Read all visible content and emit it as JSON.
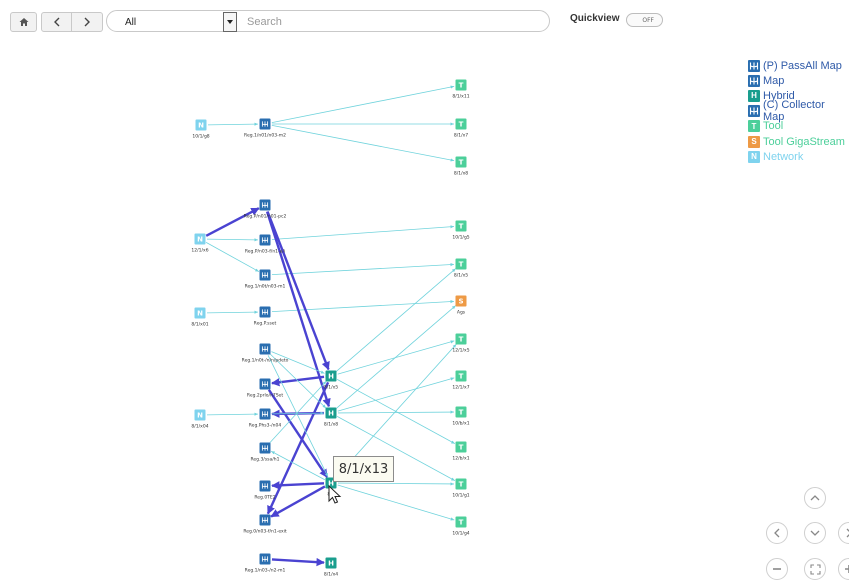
{
  "toolbar": {
    "home_icon": "home-icon",
    "back_icon": "chevron-left-icon",
    "forward_icon": "chevron-right-icon",
    "scope_value": "All",
    "search_placeholder": "Search",
    "quickview_label": "Quickview",
    "quickview_state": "OFF"
  },
  "legend": [
    {
      "badge": "",
      "icon": "passall-map-icon",
      "label": "(P) PassAll Map",
      "color": "#2a6eb0",
      "text_color": "#2f5aa8"
    },
    {
      "badge": "",
      "icon": "map-icon",
      "label": "Map",
      "color": "#2a6eb0",
      "text_color": "#2f5aa8"
    },
    {
      "badge": "H",
      "icon": "hybrid-icon",
      "label": "Hybrid",
      "color": "#1a9e8e",
      "text_color": "#2f5aa8"
    },
    {
      "badge": "",
      "icon": "collector-map-icon",
      "label": "(C) Collector Map",
      "color": "#2a6eb0",
      "text_color": "#2f5aa8"
    },
    {
      "badge": "T",
      "icon": "tool-icon",
      "label": "Tool",
      "color": "#4ccf9a",
      "text_color": "#4ccf9a"
    },
    {
      "badge": "S",
      "icon": "tool-gigastream-icon",
      "label": "Tool GigaStream",
      "color": "#ee9a45",
      "text_color": "#4ccf9a"
    },
    {
      "badge": "N",
      "icon": "network-icon",
      "label": "Network",
      "color": "#7fd3ee",
      "text_color": "#7fd3ee"
    }
  ],
  "colors": {
    "map": "#2a6eb0",
    "hybrid": "#1a9e8e",
    "tool": "#4ccf9a",
    "gigastream": "#ee9a45",
    "network": "#7fd3ee",
    "thin_edge": "#70d3dc",
    "thick_edge": "#4a43d1"
  },
  "graph": {
    "nodes": [
      {
        "id": "n1",
        "type": "N",
        "label": "10/1/g8"
      },
      {
        "id": "m1",
        "type": "M",
        "label": "Reg.1/n01/n03-m2"
      },
      {
        "id": "t1",
        "type": "T",
        "label": "8/1/x11"
      },
      {
        "id": "t2",
        "type": "T",
        "label": "8/1/x7"
      },
      {
        "id": "t3",
        "type": "T",
        "label": "8/1/x8"
      },
      {
        "id": "m2",
        "type": "M",
        "label": "Reg.P/n01/n01-pc2"
      },
      {
        "id": "n2",
        "type": "N",
        "label": "12/1/x6"
      },
      {
        "id": "m3",
        "type": "M",
        "label": "Reg.P/n03-f/n1-a/i"
      },
      {
        "id": "t4",
        "type": "T",
        "label": "10/1/g5"
      },
      {
        "id": "m4",
        "type": "M",
        "label": "Reg.1/n0t/n03-m1"
      },
      {
        "id": "t5",
        "type": "T",
        "label": "8/1/x5"
      },
      {
        "id": "n3",
        "type": "N",
        "label": "8/1/x01"
      },
      {
        "id": "m5",
        "type": "M",
        "label": "Reg.P.sset"
      },
      {
        "id": "s1",
        "type": "S",
        "label": "Ags"
      },
      {
        "id": "m6",
        "type": "M",
        "label": "Reg.1/n0t-/n/n/pdeto"
      },
      {
        "id": "t6",
        "type": "T",
        "label": "12/1/x5"
      },
      {
        "id": "h1",
        "type": "H",
        "label": "8/1/x5"
      },
      {
        "id": "m7",
        "type": "M",
        "label": "Reg.2prlo/n7Set"
      },
      {
        "id": "t7",
        "type": "T",
        "label": "12/1/x7"
      },
      {
        "id": "n4",
        "type": "N",
        "label": "8/1/x04"
      },
      {
        "id": "m8",
        "type": "M",
        "label": "Reg.Phs3-/n04"
      },
      {
        "id": "h2",
        "type": "H",
        "label": "8/1/x8"
      },
      {
        "id": "t8",
        "type": "T",
        "label": "10/b/x1"
      },
      {
        "id": "m9",
        "type": "M",
        "label": "Reg.3/ssa/h1"
      },
      {
        "id": "t9",
        "type": "T",
        "label": "12/b/x1"
      },
      {
        "id": "m10",
        "type": "M",
        "label": "Reg.0TE2"
      },
      {
        "id": "h3",
        "type": "H",
        "label": "8/1"
      },
      {
        "id": "t10",
        "type": "T",
        "label": "10/1/g1"
      },
      {
        "id": "m11",
        "type": "M",
        "label": "Reg.0/n03-f/n1-exit"
      },
      {
        "id": "t11",
        "type": "T",
        "label": "10/1/g4"
      },
      {
        "id": "m12",
        "type": "M",
        "label": "Reg.1/n03-/n2-m1"
      },
      {
        "id": "h4",
        "type": "H",
        "label": "8/1/x4"
      }
    ],
    "edges": [
      {
        "from": "n1",
        "to": "m1",
        "weight": "thin"
      },
      {
        "from": "m1",
        "to": "t1",
        "weight": "thin"
      },
      {
        "from": "m1",
        "to": "t2",
        "weight": "thin"
      },
      {
        "from": "m1",
        "to": "t3",
        "weight": "thin"
      },
      {
        "from": "n2",
        "to": "m2",
        "weight": "thick"
      },
      {
        "from": "n2",
        "to": "m3",
        "weight": "thin"
      },
      {
        "from": "n2",
        "to": "m4",
        "weight": "thin"
      },
      {
        "from": "m3",
        "to": "t4",
        "weight": "thin"
      },
      {
        "from": "m4",
        "to": "t5",
        "weight": "thin"
      },
      {
        "from": "n3",
        "to": "m5",
        "weight": "thin"
      },
      {
        "from": "m5",
        "to": "s1",
        "weight": "thin"
      },
      {
        "from": "m2",
        "to": "h1",
        "weight": "thick"
      },
      {
        "from": "m2",
        "to": "h2",
        "weight": "thick"
      },
      {
        "from": "h1",
        "to": "m7",
        "weight": "thick"
      },
      {
        "from": "h2",
        "to": "m8",
        "weight": "thick"
      },
      {
        "from": "m7",
        "to": "h3",
        "weight": "thick"
      },
      {
        "from": "h3",
        "to": "m10",
        "weight": "thick"
      },
      {
        "from": "h3",
        "to": "m11",
        "weight": "thick"
      },
      {
        "from": "h1",
        "to": "m11",
        "weight": "thick"
      },
      {
        "from": "m12",
        "to": "h4",
        "weight": "thick"
      },
      {
        "from": "n4",
        "to": "m8",
        "weight": "thin"
      },
      {
        "from": "m6",
        "to": "h1",
        "weight": "thin"
      },
      {
        "from": "m6",
        "to": "h2",
        "weight": "thin"
      },
      {
        "from": "m6",
        "to": "h3",
        "weight": "thin"
      },
      {
        "from": "m8",
        "to": "h2",
        "weight": "thin"
      },
      {
        "from": "m9",
        "to": "h1",
        "weight": "thin"
      },
      {
        "from": "h1",
        "to": "t5",
        "weight": "thin"
      },
      {
        "from": "h1",
        "to": "t6",
        "weight": "thin"
      },
      {
        "from": "h1",
        "to": "t9",
        "weight": "thin"
      },
      {
        "from": "h2",
        "to": "s1",
        "weight": "thin"
      },
      {
        "from": "h2",
        "to": "t7",
        "weight": "thin"
      },
      {
        "from": "h2",
        "to": "t8",
        "weight": "thin"
      },
      {
        "from": "h2",
        "to": "t10",
        "weight": "thin"
      },
      {
        "from": "h3",
        "to": "t6",
        "weight": "thin"
      },
      {
        "from": "h3",
        "to": "t10",
        "weight": "thin"
      },
      {
        "from": "h3",
        "to": "t11",
        "weight": "thin"
      },
      {
        "from": "h3",
        "to": "m9",
        "weight": "thin"
      }
    ]
  },
  "tooltip": {
    "text": "8/1/x13"
  },
  "nav": {
    "up_icon": "pan-up-icon",
    "left_icon": "pan-left-icon",
    "down_icon": "pan-down-icon",
    "right_icon": "pan-right-icon",
    "zoom_out_icon": "zoom-out-icon",
    "fit_icon": "fit-view-icon",
    "zoom_in_icon": "zoom-in-icon"
  }
}
